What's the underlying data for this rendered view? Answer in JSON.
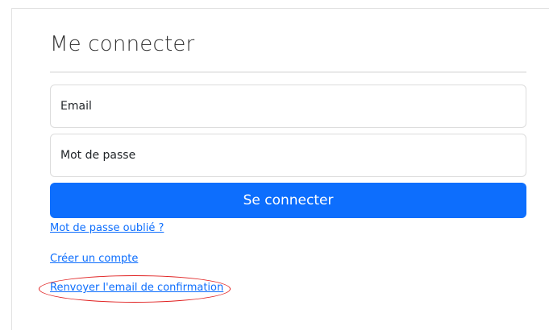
{
  "login": {
    "title": "Me connecter",
    "email_placeholder": "Email",
    "password_placeholder": "Mot de passe",
    "submit_label": "Se connecter",
    "forgot_password_link": "Mot de passe oublié ?",
    "create_account_link": "Créer un compte",
    "resend_confirmation_link": "Renvoyer l'email de confirmation"
  },
  "colors": {
    "primary": "#0d6efd",
    "annotation": "#e02020"
  }
}
